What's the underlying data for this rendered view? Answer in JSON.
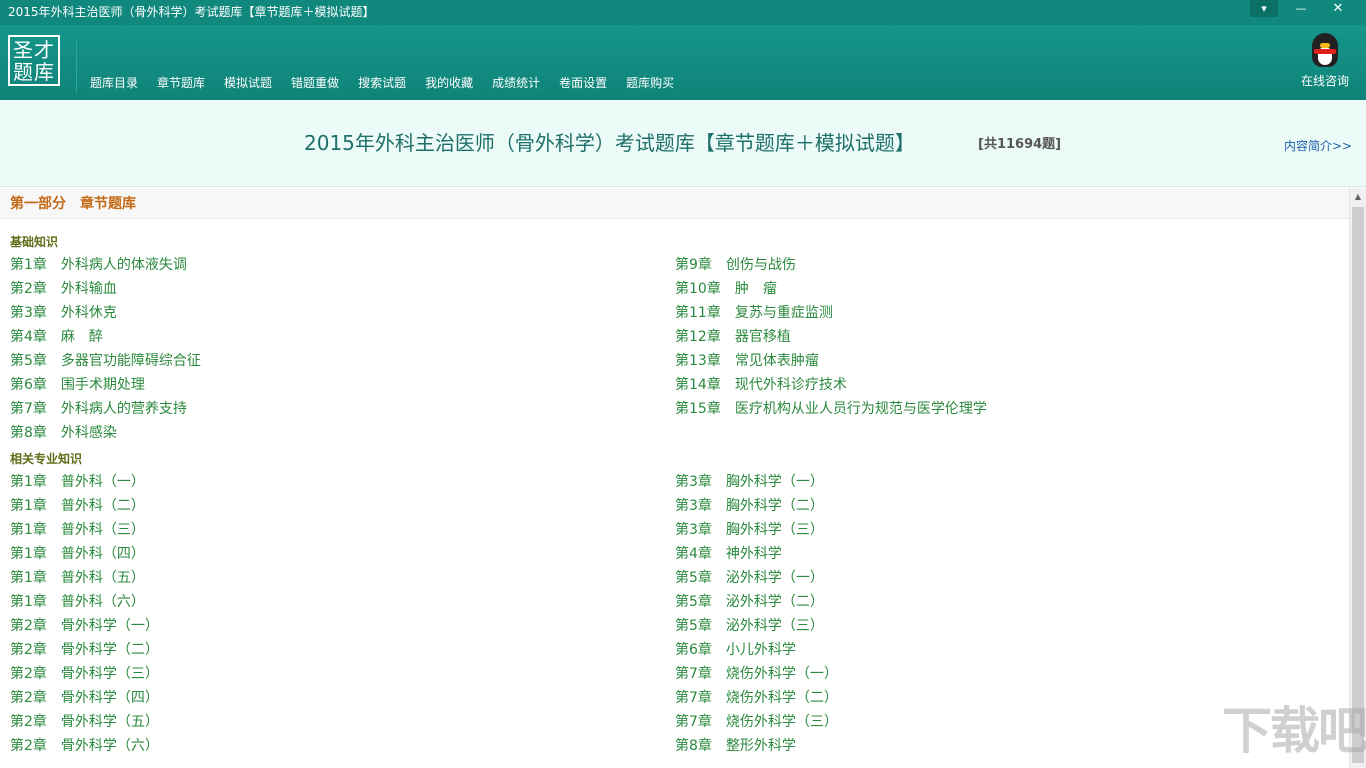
{
  "window": {
    "title": "2015年外科主治医师（骨外科学）考试题库【章节题库＋模拟试题】",
    "controls": {
      "menu": "▾",
      "minimize": "—",
      "close": "✕"
    }
  },
  "header": {
    "logo_line1": "圣才",
    "logo_line2": "题库",
    "nav": [
      "题库目录",
      "章节题库",
      "模拟试题",
      "错题重做",
      "搜索试题",
      "我的收藏",
      "成绩统计",
      "卷面设置",
      "题库购买"
    ],
    "online_consult": "在线咨询"
  },
  "banner": {
    "title": "2015年外科主治医师（骨外科学）考试题库【章节题库＋模拟试题】",
    "count": "[共11694题]",
    "intro_link": "内容简介>>"
  },
  "content": {
    "part_title": "第一部分　章节题库",
    "sections": [
      {
        "title": "基础知识",
        "left": [
          [
            "第1章",
            "外科病人的体液失调"
          ],
          [
            "第2章",
            "外科输血"
          ],
          [
            "第3章",
            "外科休克"
          ],
          [
            "第4章",
            "麻　醉"
          ],
          [
            "第5章",
            "多器官功能障碍综合征"
          ],
          [
            "第6章",
            "围手术期处理"
          ],
          [
            "第7章",
            "外科病人的营养支持"
          ],
          [
            "第8章",
            "外科感染"
          ]
        ],
        "right": [
          [
            "第9章",
            "创伤与战伤"
          ],
          [
            "第10章",
            "肿　瘤"
          ],
          [
            "第11章",
            "复苏与重症监测"
          ],
          [
            "第12章",
            "器官移植"
          ],
          [
            "第13章",
            "常见体表肿瘤"
          ],
          [
            "第14章",
            "现代外科诊疗技术"
          ],
          [
            "第15章",
            "医疗机构从业人员行为规范与医学伦理学"
          ]
        ]
      },
      {
        "title": "相关专业知识",
        "left": [
          [
            "第1章",
            "普外科（一）"
          ],
          [
            "第1章",
            "普外科（二）"
          ],
          [
            "第1章",
            "普外科（三）"
          ],
          [
            "第1章",
            "普外科（四）"
          ],
          [
            "第1章",
            "普外科（五）"
          ],
          [
            "第1章",
            "普外科（六）"
          ],
          [
            "第2章",
            "骨外科学（一）"
          ],
          [
            "第2章",
            "骨外科学（二）"
          ],
          [
            "第2章",
            "骨外科学（三）"
          ],
          [
            "第2章",
            "骨外科学（四）"
          ],
          [
            "第2章",
            "骨外科学（五）"
          ],
          [
            "第2章",
            "骨外科学（六）"
          ]
        ],
        "right": [
          [
            "第3章",
            "胸外科学（一）"
          ],
          [
            "第3章",
            "胸外科学（二）"
          ],
          [
            "第3章",
            "胸外科学（三）"
          ],
          [
            "第4章",
            "神外科学"
          ],
          [
            "第5章",
            "泌外科学（一）"
          ],
          [
            "第5章",
            "泌外科学（二）"
          ],
          [
            "第5章",
            "泌外科学（三）"
          ],
          [
            "第6章",
            "小儿外科学"
          ],
          [
            "第7章",
            "烧伤外科学（一）"
          ],
          [
            "第7章",
            "烧伤外科学（二）"
          ],
          [
            "第7章",
            "烧伤外科学（三）"
          ],
          [
            "第8章",
            "整形外科学"
          ]
        ]
      }
    ]
  },
  "watermark": "下载吧",
  "colors": {
    "header": "#11887e",
    "banner_bg": "#ecfbf8",
    "title_text": "#1e6f6a",
    "part_title": "#c46a17",
    "section_title": "#5e6e1a",
    "chapter_link": "#2b8a3e",
    "intro_link": "#1e5fa8"
  }
}
